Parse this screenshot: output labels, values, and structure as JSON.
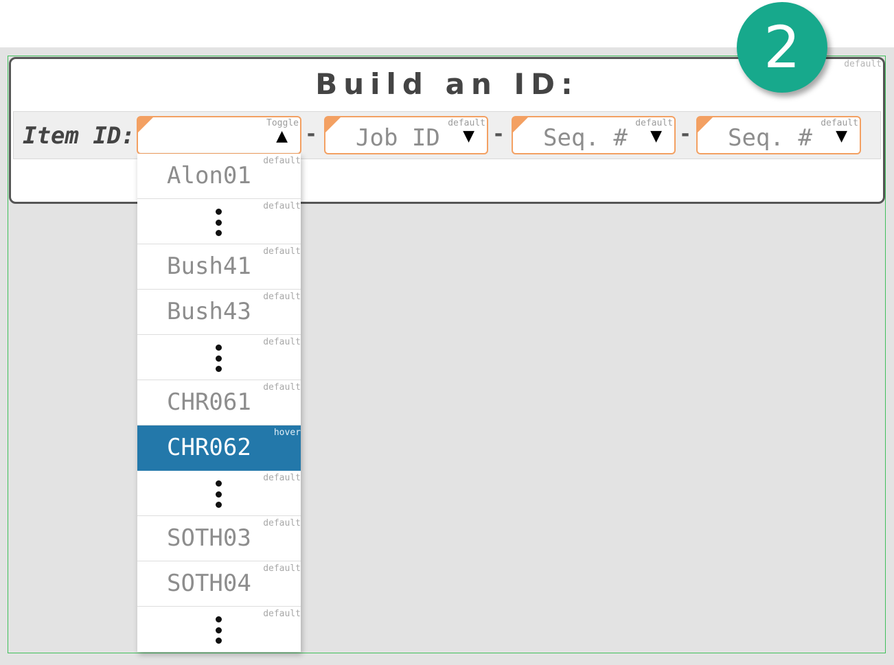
{
  "step_badge": "2",
  "card": {
    "title": "Build an ID:",
    "state": "default"
  },
  "item_label": "Item ID:",
  "separator": "-",
  "selects": {
    "item": {
      "state": "Toggle",
      "value": "",
      "caret": "▲"
    },
    "job": {
      "state": "default",
      "placeholder": "Job ID",
      "caret": "▼"
    },
    "seq1": {
      "state": "default",
      "placeholder": "Seq. #",
      "caret": "▼"
    },
    "seq2": {
      "state": "default",
      "placeholder": "Seq. #",
      "caret": "▼"
    }
  },
  "dropdown": {
    "options": [
      {
        "label": "Alon01",
        "state": "default"
      },
      {
        "label": "",
        "state": "default",
        "ellipsis": true
      },
      {
        "label": "Bush41",
        "state": "default"
      },
      {
        "label": "Bush43",
        "state": "default"
      },
      {
        "label": "",
        "state": "default",
        "ellipsis": true
      },
      {
        "label": "CHR061",
        "state": "default"
      },
      {
        "label": "CHR062",
        "state": "hover"
      },
      {
        "label": "",
        "state": "default",
        "ellipsis": true
      },
      {
        "label": "SOTH03",
        "state": "default"
      },
      {
        "label": "SOTH04",
        "state": "default"
      },
      {
        "label": "",
        "state": "default",
        "ellipsis": true
      }
    ]
  }
}
